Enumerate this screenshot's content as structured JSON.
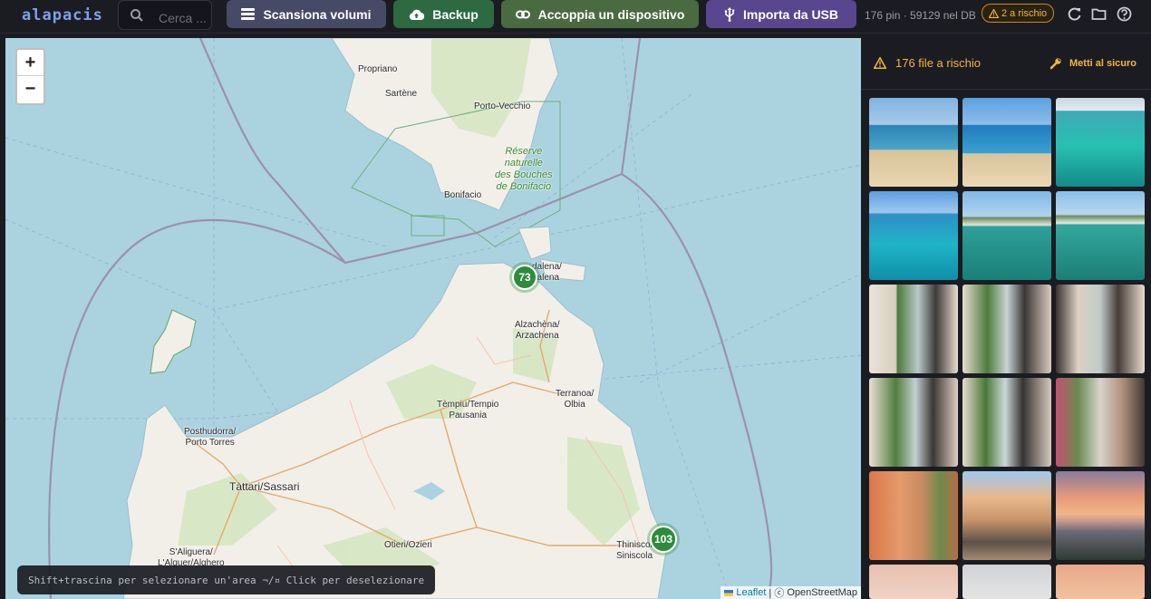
{
  "app": {
    "brand": "alapacis"
  },
  "search": {
    "placeholder": "Cerca ..."
  },
  "toolbar": {
    "scan_label": "Scansiona volumi",
    "backup_label": "Backup",
    "pair_label": "Accoppia un dispositivo",
    "usb_label": "Importa da USB",
    "stats": "176 pin · 59129 nel DB",
    "risk_badge": "2 a rischio"
  },
  "icons": {
    "search": "search-icon",
    "scan": "list-icon",
    "backup": "cloud-upload-icon",
    "pair": "link-icon",
    "usb": "usb-icon",
    "refresh": "refresh-icon",
    "folder": "folder-icon",
    "help": "help-icon",
    "warning": "warning-icon",
    "wrench": "wrench-icon"
  },
  "map": {
    "zoom_in": "+",
    "zoom_out": "−",
    "clusters": [
      {
        "count": "73"
      },
      {
        "count": "103"
      }
    ],
    "hint": "Shift+trascina per selezionare un'area ¬∕¤ Click per deselezionare",
    "attribution_link": "Leaflet",
    "attribution_sep": "| ⓒ",
    "attribution_text": "OpenStreetMap",
    "labels": {
      "propriano": "Propriano",
      "sartene": "Sartène",
      "porto_vecchio": "Porto-Vecchio",
      "bonifacio": "Bonifacio",
      "reserve": "Réserve\nnaturelle\ndes Bouches\nde Bonifacio",
      "maddalena": "dalena/\ndalena",
      "arzachena": "Alzachèna/\nArzachena",
      "tempio": "Tèmpiu/Tempio\nPausania",
      "olbia": "Terranoa/\nOlbia",
      "porto_torres": "Posthudorra/\nPorto Torres",
      "sassari": "Tàttari/Sassari",
      "alghero": "S'Aliguera/\nL'Alguer/Alghero",
      "ozieri": "Otieri/Ozieri",
      "siniscola": "Thiniscol\nSiniscola"
    }
  },
  "panel": {
    "risk_title": "176 file a rischio",
    "fix_label": "Metti al sicuro"
  },
  "colors": {
    "sea": "#aad3df",
    "land": "#f2efe9",
    "accent_warning": "#f3b543",
    "cluster": "#2e8b3c"
  }
}
